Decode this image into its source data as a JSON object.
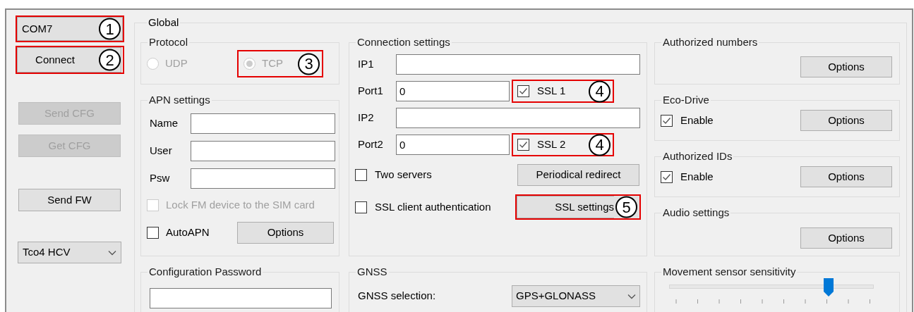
{
  "port_button": {
    "label": "COM7",
    "highlighted": true,
    "callout": "1"
  },
  "left_buttons": [
    {
      "label": "Connect",
      "disabled": false,
      "highlighted": true,
      "callout": "2"
    },
    {
      "label": "Send CFG",
      "disabled": true,
      "highlighted": false
    },
    {
      "label": "Get CFG",
      "disabled": true,
      "highlighted": false
    },
    {
      "label": "Send FW",
      "disabled": false,
      "highlighted": false
    }
  ],
  "device_select": {
    "value": "Tco4 HCV"
  },
  "global": {
    "title": "Global",
    "protocol": {
      "title": "Protocol",
      "options": [
        {
          "label": "UDP",
          "selected": false,
          "disabled": true,
          "highlighted": false
        },
        {
          "label": "TCP",
          "selected": true,
          "disabled": true,
          "highlighted": true,
          "callout": "3"
        }
      ]
    },
    "apn_settings": {
      "title": "APN settings",
      "fields": [
        {
          "label": "Name"
        },
        {
          "label": "User"
        },
        {
          "label": "Psw"
        }
      ],
      "lock_sim": {
        "label": "Lock FM device to the SIM card",
        "checked": false,
        "disabled": true
      },
      "auto_apn": {
        "label": "AutoAPN",
        "checked": false,
        "disabled": false
      },
      "options_button": "Options"
    },
    "configuration_password": {
      "title": "Configuration Password"
    },
    "connection_settings": {
      "title": "Connection settings",
      "servers": [
        {
          "ip_label": "IP1",
          "port_label": "Port1",
          "port_value": "0",
          "ssl": {
            "label": "SSL 1",
            "checked": true,
            "highlighted": true,
            "callout": "4"
          }
        },
        {
          "ip_label": "IP2",
          "port_label": "Port2",
          "port_value": "0",
          "ssl": {
            "label": "SSL 2",
            "checked": true,
            "highlighted": true,
            "callout": "4"
          }
        }
      ],
      "two_servers": {
        "label": "Two servers",
        "checked": false
      },
      "periodical_redirect": {
        "label": "Periodical redirect",
        "highlighted": false
      },
      "ssl_client_auth": {
        "label": "SSL client authentication",
        "checked": false
      },
      "ssl_settings": {
        "label": "SSL settings",
        "highlighted": true,
        "callout": "5"
      }
    },
    "gnss": {
      "title": "GNSS",
      "label": "GNSS selection:",
      "value": "GPS+GLONASS"
    },
    "right_groups": [
      {
        "title": "Authorized numbers",
        "kind": "button",
        "button": "Options"
      },
      {
        "title": "Eco-Drive",
        "kind": "checkbox",
        "checkbox": {
          "label": "Enable",
          "checked": true
        },
        "button": "Options"
      },
      {
        "title": "Authorized IDs",
        "kind": "checkbox",
        "checkbox": {
          "label": "Enable",
          "checked": true
        },
        "button": "Options"
      },
      {
        "title": "Audio settings",
        "kind": "button",
        "button": "Options"
      }
    ],
    "movement_sensor": {
      "title": "Movement sensor sensitivity",
      "level": 0.78
    }
  }
}
